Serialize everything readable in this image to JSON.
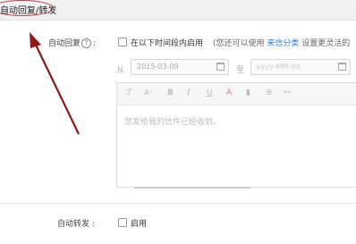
{
  "header": {
    "title": "自动回复/转发"
  },
  "auto_reply": {
    "label": "自动回复",
    "help_glyph": "?",
    "colon": ":",
    "period_checkbox_label": "在以下时间段内启用",
    "hint_prefix": "(您还可以使用",
    "hint_link": "来信分类",
    "hint_suffix": "设置更灵活的"
  },
  "date_range": {
    "from_label": "从",
    "from_value": "2015-03-09",
    "to_label": "至",
    "to_placeholder": "yyyy-MM-dd"
  },
  "editor": {
    "toolbar_icons": [
      "font-icon",
      "font-size-icon",
      "bold-icon",
      "italic-icon",
      "underline-icon",
      "font-color-icon",
      "highlight-icon",
      "align-icon",
      "link-icon"
    ],
    "toolbar_glyphs": [
      "ℱ",
      "Aᴬ",
      "B",
      "I",
      "U",
      "A",
      "▮",
      "≣",
      "⚯"
    ],
    "placeholder": "您发给我的信件已经收到。"
  },
  "auto_forward": {
    "label": "自动转发",
    "colon": ":",
    "checkbox_label": "启用"
  },
  "colors": {
    "link": "#2b7bd8",
    "annotation": "#8b1a1a"
  }
}
